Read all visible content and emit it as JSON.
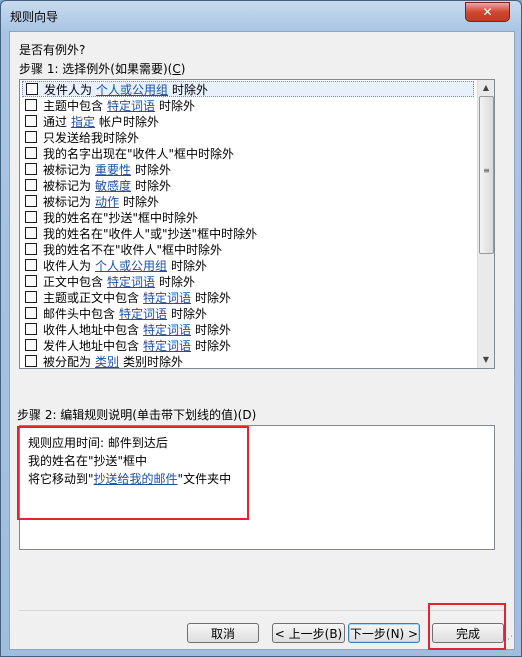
{
  "window": {
    "title": "规则向导",
    "close_label": "✕"
  },
  "question": "是否有例外?",
  "step1": {
    "label_prefix": "步骤 1: 选择例外(如果需要)(",
    "hotkey": "C",
    "label_suffix": ")"
  },
  "exceptions": [
    {
      "pre": "发件人为",
      "link": "个人或公用组",
      "post": "时除外",
      "selected": true
    },
    {
      "pre": "主题中包含",
      "link": "特定词语",
      "post": "时除外"
    },
    {
      "pre": "通过",
      "link": "指定",
      "post": "帐户时除外"
    },
    {
      "pre": "只发送给我时除外"
    },
    {
      "pre": "我的名字出现在\"收件人\"框中时除外"
    },
    {
      "pre": "被标记为",
      "link": "重要性",
      "post": "时除外"
    },
    {
      "pre": "被标记为",
      "link": "敏感度",
      "post": "时除外"
    },
    {
      "pre": "被标记为",
      "link": "动作",
      "post": "时除外"
    },
    {
      "pre": "我的姓名在\"抄送\"框中时除外"
    },
    {
      "pre": "我的姓名在\"收件人\"或\"抄送\"框中时除外"
    },
    {
      "pre": "我的姓名不在\"收件人\"框中时除外"
    },
    {
      "pre": "收件人为",
      "link": "个人或公用组",
      "post": "时除外"
    },
    {
      "pre": "正文中包含",
      "link": "特定词语",
      "post": "时除外"
    },
    {
      "pre": "主题或正文中包含",
      "link": "特定词语",
      "post": "时除外"
    },
    {
      "pre": "邮件头中包含",
      "link": "特定词语",
      "post": "时除外"
    },
    {
      "pre": "收件人地址中包含",
      "link": "特定词语",
      "post": "时除外"
    },
    {
      "pre": "发件人地址中包含",
      "link": "特定词语",
      "post": "时除外"
    },
    {
      "pre": "被分配为",
      "link": "类别",
      "post": "类别时除外"
    }
  ],
  "step2": {
    "label": "步骤 2: 编辑规则说明(单击带下划线的值)(D)"
  },
  "description": {
    "line1": "规则应用时间: 邮件到达后",
    "line2": "我的姓名在\"抄送\"框中",
    "line3_pre": "将它移动到\"",
    "line3_link": "抄送给我的邮件",
    "line3_post": "\"文件夹中"
  },
  "buttons": {
    "cancel": "取消",
    "back": "< 上一步(B)",
    "next": "下一步(N) >",
    "finish": "完成"
  },
  "colors": {
    "highlight": "#e5232e",
    "link": "#1e4fa0"
  }
}
